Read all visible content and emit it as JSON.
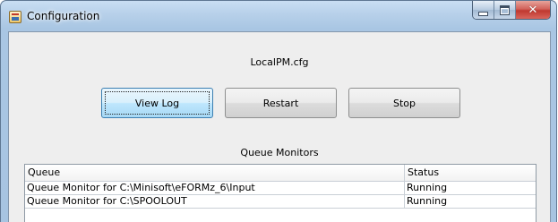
{
  "window": {
    "title": "Configuration",
    "icon": "java-app-icon",
    "controls": [
      "minimize-icon",
      "maximize-icon",
      "close-icon"
    ]
  },
  "config_file": "LocalPM.cfg",
  "buttons": {
    "view_log": "View Log",
    "restart": "Restart",
    "stop": "Stop"
  },
  "queue_monitors": {
    "title": "Queue Monitors",
    "columns": {
      "queue": "Queue",
      "status": "Status"
    },
    "rows": [
      {
        "queue": "Queue Monitor for C:\\Minisoft\\eFORMz_6\\Input",
        "status": "Running"
      },
      {
        "queue": "Queue Monitor for C:\\SPOOLOUT",
        "status": "Running"
      }
    ]
  }
}
